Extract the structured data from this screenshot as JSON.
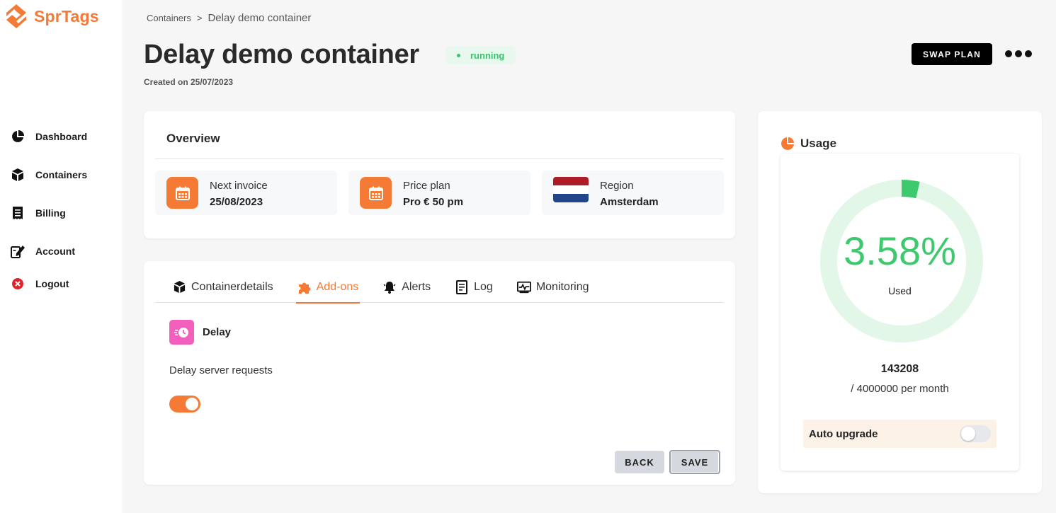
{
  "app": {
    "logo_part1": "Spr",
    "logo_part2": "Tags"
  },
  "sidebar": {
    "items": [
      {
        "label": "Dashboard",
        "icon": "pie-chart-icon"
      },
      {
        "label": "Containers",
        "icon": "box-icon"
      },
      {
        "label": "Billing",
        "icon": "receipt-icon"
      },
      {
        "label": "Account",
        "icon": "edit-account-icon"
      },
      {
        "label": "Logout",
        "icon": "logout-circle-icon"
      }
    ]
  },
  "header": {
    "breadcrumb_root": "Containers",
    "breadcrumb_sep": ">",
    "breadcrumb_current": "Delay demo container",
    "title": "Delay demo container",
    "status": "running",
    "created": "Created on 25/07/2023",
    "swap_plan_label": "SWAP PLAN"
  },
  "overview": {
    "title": "Overview",
    "next_invoice_label": "Next invoice",
    "next_invoice_value": "25/08/2023",
    "price_plan_label": "Price plan",
    "price_plan_value": "Pro € 50 pm",
    "region_label": "Region",
    "region_value": "Amsterdam"
  },
  "tabs": [
    {
      "label": "Containerdetails",
      "icon": "box-icon",
      "active": false
    },
    {
      "label": "Add-ons",
      "icon": "puzzle-icon",
      "active": true
    },
    {
      "label": "Alerts",
      "icon": "bell-icon",
      "active": false
    },
    {
      "label": "Log",
      "icon": "document-icon",
      "active": false
    },
    {
      "label": "Monitoring",
      "icon": "monitor-icon",
      "active": false
    }
  ],
  "addon": {
    "name": "Delay",
    "description": "Delay server requests",
    "enabled": true,
    "back_label": "BACK",
    "save_label": "SAVE"
  },
  "usage": {
    "title": "Usage",
    "percent_text": "3.58%",
    "percent_value": 3.58,
    "used_label": "Used",
    "count": "143208",
    "limit": "/ 4000000 per month",
    "auto_upgrade_label": "Auto upgrade",
    "auto_upgrade_enabled": false
  },
  "colors": {
    "accent": "#f47a36",
    "success": "#3fc96e",
    "gauge_track": "#e3f7e9",
    "addon": "#f45fbd"
  }
}
